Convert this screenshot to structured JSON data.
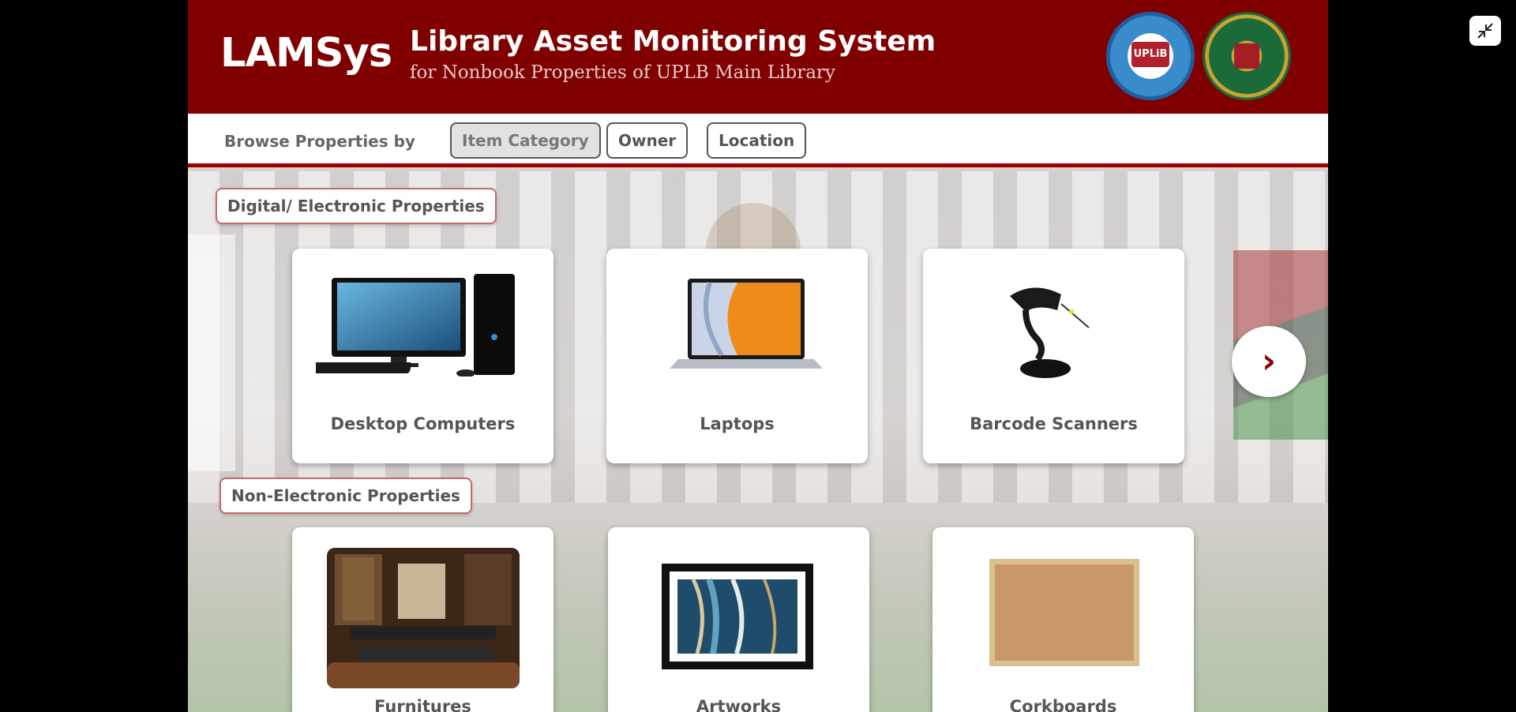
{
  "header": {
    "brand": "LAMSys",
    "title": "Library Asset Monitoring System",
    "subtitle": "for Nonbook Properties of UPLB Main Library",
    "logos": [
      {
        "name": "uplb-library-logo",
        "text": "UPLiB"
      },
      {
        "name": "up-los-banos-seal"
      }
    ]
  },
  "browse": {
    "label": "Browse Properties by",
    "options": [
      "Item Category",
      "Owner",
      "Location"
    ],
    "active": "Item Category"
  },
  "sections": [
    {
      "label": "Digital/ Electronic Properties",
      "items": [
        {
          "label": "Desktop Computers",
          "icon": "desktop-computer-image"
        },
        {
          "label": "Laptops",
          "icon": "laptop-image"
        },
        {
          "label": "Barcode Scanners",
          "icon": "barcode-scanner-image"
        }
      ]
    },
    {
      "label": "Non-Electronic Properties",
      "items": [
        {
          "label": "Furnitures",
          "icon": "furniture-image"
        },
        {
          "label": "Artworks",
          "icon": "artwork-image"
        },
        {
          "label": "Corkboards",
          "icon": "corkboard-image"
        }
      ]
    }
  ],
  "icons": {
    "next": "chevron-right-icon",
    "exit_fullscreen": "exit-fullscreen-icon"
  },
  "colors": {
    "brand": "#800000",
    "accent": "#a00000"
  }
}
